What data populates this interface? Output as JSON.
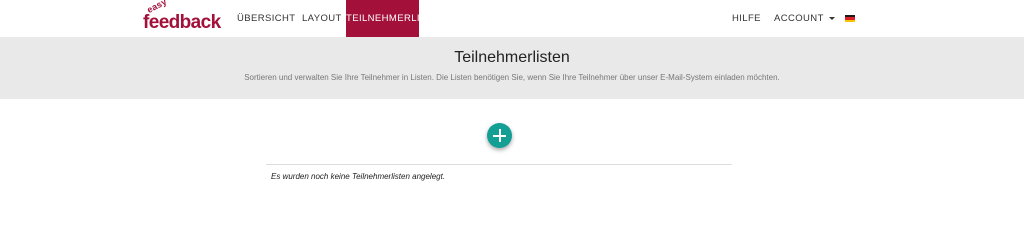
{
  "brand": {
    "logo_top": "easy",
    "logo_main": "feedback",
    "color": "#a3113a"
  },
  "nav": {
    "items": [
      {
        "label": "ÜBERSICHT",
        "active": false
      },
      {
        "label": "LAYOUT",
        "active": false
      },
      {
        "label": "TEILNEHMERLISTEN",
        "active": true
      }
    ],
    "right": {
      "help": "HILFE",
      "account": "ACCOUNT",
      "language_icon": "flag-de-icon"
    }
  },
  "header": {
    "title": "Teilnehmerlisten",
    "subtitle": "Sortieren und verwalten Sie Ihre Teilnehmer in Listen. Die Listen benötigen Sie, wenn Sie Ihre Teilnehmer über unser E-Mail-System einladen möchten."
  },
  "main": {
    "add_button_icon": "plus-icon",
    "add_button_color": "#149f95",
    "empty_message": "Es wurden noch keine Teilnehmerlisten angelegt."
  },
  "colors": {
    "header_band": "#e9e9e9",
    "accent": "#a3113a",
    "action": "#149f95"
  }
}
